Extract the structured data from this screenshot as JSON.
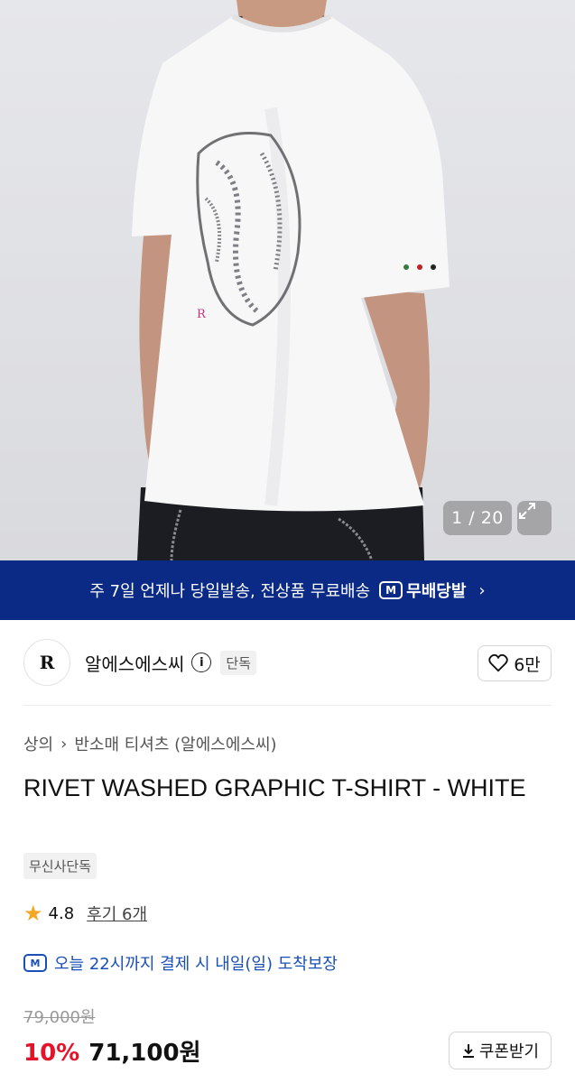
{
  "gallery": {
    "counter": "1 / 20"
  },
  "banner": {
    "text": "주 7일 언제나 당일발송, 전상품 무료배송",
    "badge_icon": "M",
    "badge_label": "무배당발"
  },
  "brand": {
    "logo": "R",
    "name": "알에스에스씨",
    "exclusive_label": "단독",
    "likes": "6만"
  },
  "breadcrumb": {
    "category": "상의",
    "subcategory": "반소매 티셔츠 (알에스에스씨)"
  },
  "product": {
    "title": "RIVET WASHED GRAPHIC T-SHIRT - WHITE",
    "tag": "무신사단독"
  },
  "rating": {
    "score": "4.8",
    "reviews": "후기 6개"
  },
  "delivery": {
    "icon": "M",
    "text": "오늘 22시까지 결제 시 내일(일) 도착보장"
  },
  "pricing": {
    "original": "79,000원",
    "discount": "10%",
    "price": "71,100원",
    "coupon_label": "쿠폰받기"
  },
  "colors": {
    "banner_bg": "#0a2a86",
    "discount": "#e5132a",
    "delivery": "#1a4fb5",
    "star": "#f5a623"
  }
}
